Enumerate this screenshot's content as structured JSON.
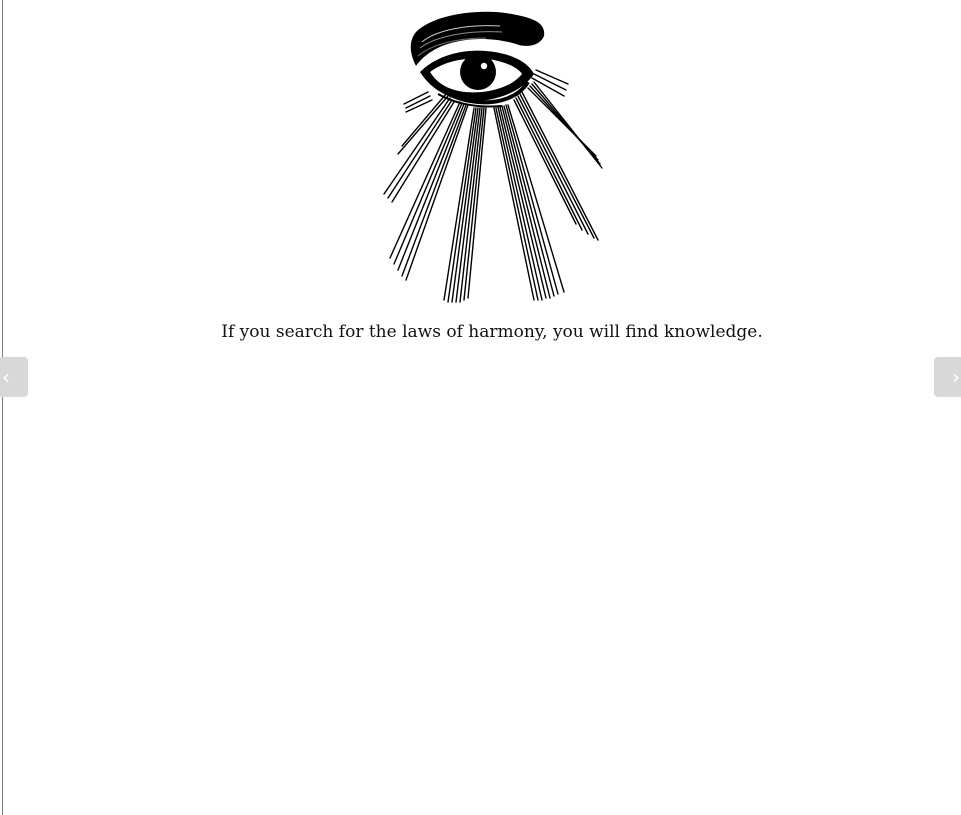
{
  "content": {
    "caption": "If you search for the laws of harmony, you will find knowledge.",
    "illustration_icon": "all-seeing-eye-with-rays-icon"
  },
  "navigation": {
    "prev_glyph": "‹",
    "next_glyph": "›",
    "prev_icon": "chevron-left-icon",
    "next_icon": "chevron-right-icon"
  },
  "colors": {
    "background": "#ffffff",
    "text": "#111111",
    "nav_button": "#d8d8d8",
    "border": "#7a7a7a"
  }
}
